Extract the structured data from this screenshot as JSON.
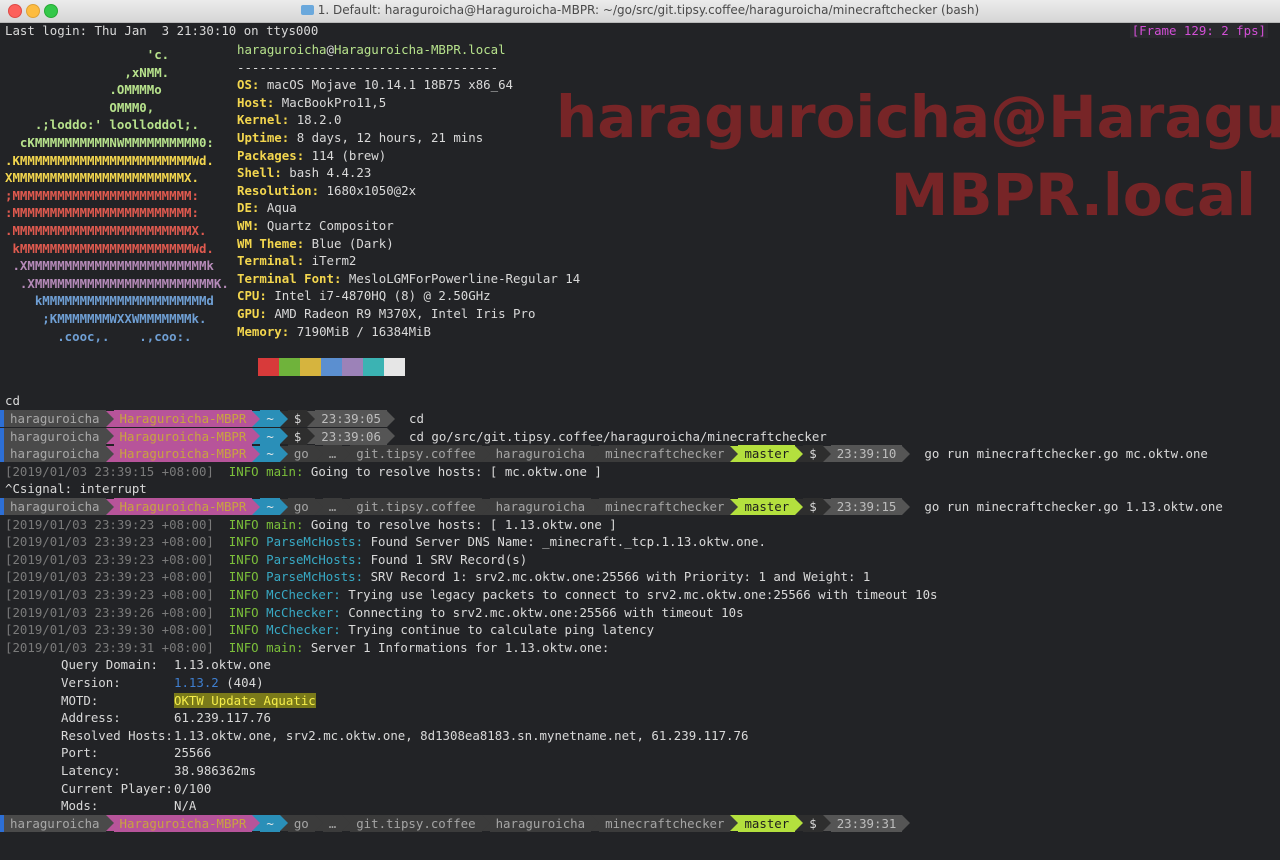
{
  "window": {
    "title": "1. Default: haraguroicha@Haraguroicha-MBPR: ~/go/src/git.tipsy.coffee/haraguroicha/minecraftchecker (bash)"
  },
  "frame_badge": "[Frame 129: 2 fps]",
  "big_host": "haraguroicha@Haraguroicha-MBPR.local",
  "last_login": "Last login: Thu Jan  3 21:30:10 on ttys000",
  "logo": [
    {
      "text": "                   'c.",
      "color": "#b7e28c"
    },
    {
      "text": "                ,xNMM.",
      "color": "#b7e28c"
    },
    {
      "text": "              .OMMMMo",
      "color": "#b7e28c"
    },
    {
      "text": "              OMMM0,",
      "color": "#b7e28c"
    },
    {
      "text": "    .;loddo:' loolloddol;.",
      "color": "#b7e28c"
    },
    {
      "text": "  cKMMMMMMMMMMNWMMMMMMMMMM0:",
      "color": "#b7e28c"
    },
    {
      "text": ".KMMMMMMMMMMMMMMMMMMMMMMMWd.",
      "color": "#f3d64e"
    },
    {
      "text": "XMMMMMMMMMMMMMMMMMMMMMMMX.",
      "color": "#f3d64e"
    },
    {
      "text": ";MMMMMMMMMMMMMMMMMMMMMMMM:",
      "color": "#e05a4f"
    },
    {
      "text": ":MMMMMMMMMMMMMMMMMMMMMMMM:",
      "color": "#e05a4f"
    },
    {
      "text": ".MMMMMMMMMMMMMMMMMMMMMMMMX.",
      "color": "#e05a4f"
    },
    {
      "text": " kMMMMMMMMMMMMMMMMMMMMMMMWd.",
      "color": "#e05a4f"
    },
    {
      "text": " .XMMMMMMMMMMMMMMMMMMMMMMMMk",
      "color": "#b58ab8"
    },
    {
      "text": "  .XMMMMMMMMMMMMMMMMMMMMMMMMK.",
      "color": "#b58ab8"
    },
    {
      "text": "    kMMMMMMMMMMMMMMMMMMMMMMd",
      "color": "#6f9fd4"
    },
    {
      "text": "     ;KMMMMMMMWXXWMMMMMMMk.",
      "color": "#6f9fd4"
    },
    {
      "text": "       .cooc,.    .,coo:.",
      "color": "#6f9fd4"
    }
  ],
  "sysinfo": {
    "user": "haraguroicha",
    "at": "@",
    "host": "Haraguroicha-MBPR.local",
    "rule": "-----------------------------------",
    "rows": [
      {
        "key": "OS",
        "value": "macOS Mojave 10.14.1 18B75 x86_64"
      },
      {
        "key": "Host",
        "value": "MacBookPro11,5"
      },
      {
        "key": "Kernel",
        "value": "18.2.0"
      },
      {
        "key": "Uptime",
        "value": "8 days, 12 hours, 21 mins"
      },
      {
        "key": "Packages",
        "value": "114 (brew)"
      },
      {
        "key": "Shell",
        "value": "bash 4.4.23"
      },
      {
        "key": "Resolution",
        "value": "1680x1050@2x"
      },
      {
        "key": "DE",
        "value": "Aqua"
      },
      {
        "key": "WM",
        "value": "Quartz Compositor"
      },
      {
        "key": "WM Theme",
        "value": "Blue (Dark)"
      },
      {
        "key": "Terminal",
        "value": "iTerm2"
      },
      {
        "key": "Terminal Font",
        "value": "MesloLGMForPowerline-Regular 14"
      },
      {
        "key": "CPU",
        "value": "Intel i7-4870HQ (8) @ 2.50GHz"
      },
      {
        "key": "GPU",
        "value": "AMD Radeon R9 M370X, Intel Iris Pro"
      },
      {
        "key": "Memory",
        "value": "7190MiB / 16384MiB"
      }
    ],
    "palette": [
      "#d83a3a",
      "#6fb33b",
      "#d6b43e",
      "#5b8fd0",
      "#9c82b8",
      "#3bb3b3",
      "#e6e6e6"
    ]
  },
  "cd_cmd": "cd",
  "prompts": [
    {
      "segments": [
        "haraguroicha",
        "Haraguroicha-MBPR",
        "~",
        "$",
        "23:39:05"
      ],
      "cmd": "cd"
    },
    {
      "segments": [
        "haraguroicha",
        "Haraguroicha-MBPR",
        "~",
        "$",
        "23:39:06"
      ],
      "cmd": "cd go/src/git.tipsy.coffee/haraguroicha/minecraftchecker"
    },
    {
      "segments": [
        "haraguroicha",
        "Haraguroicha-MBPR",
        "~",
        "go",
        "…",
        "git.tipsy.coffee",
        "haraguroicha",
        "minecraftchecker",
        "master",
        "$",
        "23:39:10"
      ],
      "cmd": "go run minecraftchecker.go mc.oktw.one"
    },
    {
      "segments": [
        "haraguroicha",
        "Haraguroicha-MBPR",
        "~",
        "go",
        "…",
        "git.tipsy.coffee",
        "haraguroicha",
        "minecraftchecker",
        "master",
        "$",
        "23:39:15"
      ],
      "cmd": "go run minecraftchecker.go 1.13.oktw.one"
    },
    {
      "segments": [
        "haraguroicha",
        "Haraguroicha-MBPR",
        "~",
        "go",
        "…",
        "git.tipsy.coffee",
        "haraguroicha",
        "minecraftchecker",
        "master",
        "$",
        "23:39:31"
      ],
      "cmd": ""
    }
  ],
  "log1": {
    "ts": "[2019/01/03 23:39:15 +08:00]",
    "level": "INFO",
    "module": "main:",
    "msg": "Going to resolve hosts: [ mc.oktw.one ]"
  },
  "interrupt": "^Csignal: interrupt",
  "logs": [
    {
      "ts": "[2019/01/03 23:39:23 +08:00]",
      "level": "INFO",
      "module": "main:",
      "msg": "Going to resolve hosts: [ 1.13.oktw.one ]"
    },
    {
      "ts": "[2019/01/03 23:39:23 +08:00]",
      "level": "INFO",
      "module": "ParseMcHosts:",
      "msg": "Found Server DNS Name: _minecraft._tcp.1.13.oktw.one."
    },
    {
      "ts": "[2019/01/03 23:39:23 +08:00]",
      "level": "INFO",
      "module": "ParseMcHosts:",
      "msg": "Found 1 SRV Record(s)"
    },
    {
      "ts": "[2019/01/03 23:39:23 +08:00]",
      "level": "INFO",
      "module": "ParseMcHosts:",
      "msg": "SRV Record 1: srv2.mc.oktw.one:25566 with Priority: 1 and Weight: 1"
    },
    {
      "ts": "[2019/01/03 23:39:23 +08:00]",
      "level": "INFO",
      "module": "McChecker:",
      "msg": "Trying use legacy packets to connect to srv2.mc.oktw.one:25566 with timeout 10s"
    },
    {
      "ts": "[2019/01/03 23:39:26 +08:00]",
      "level": "INFO",
      "module": "McChecker:",
      "msg": "Connecting to srv2.mc.oktw.one:25566 with timeout 10s"
    },
    {
      "ts": "[2019/01/03 23:39:30 +08:00]",
      "level": "INFO",
      "module": "McChecker:",
      "msg": "Trying continue to calculate ping latency"
    },
    {
      "ts": "[2019/01/03 23:39:31 +08:00]",
      "level": "INFO",
      "module": "main:",
      "msg": "Server 1 Informations for 1.13.oktw.one:"
    }
  ],
  "details": {
    "query_domain_key": "Query Domain:",
    "query_domain": "1.13.oktw.one",
    "version_key": "Version:",
    "version": "1.13.2",
    "protocol": "(404)",
    "motd_key": "MOTD:",
    "motd": "OKTW Update Aquatic",
    "address_key": "Address:",
    "address": "61.239.117.76",
    "resolved_key": "Resolved Hosts:",
    "resolved": "1.13.oktw.one, srv2.mc.oktw.one, 8d1308ea8183.sn.mynetname.net, 61.239.117.76",
    "port_key": "Port:",
    "port": "25566",
    "latency_key": "Latency:",
    "latency": "38.986362ms",
    "player_key": "Current Player:",
    "player": "0/100",
    "mods_key": "Mods:",
    "mods": "N/A"
  }
}
